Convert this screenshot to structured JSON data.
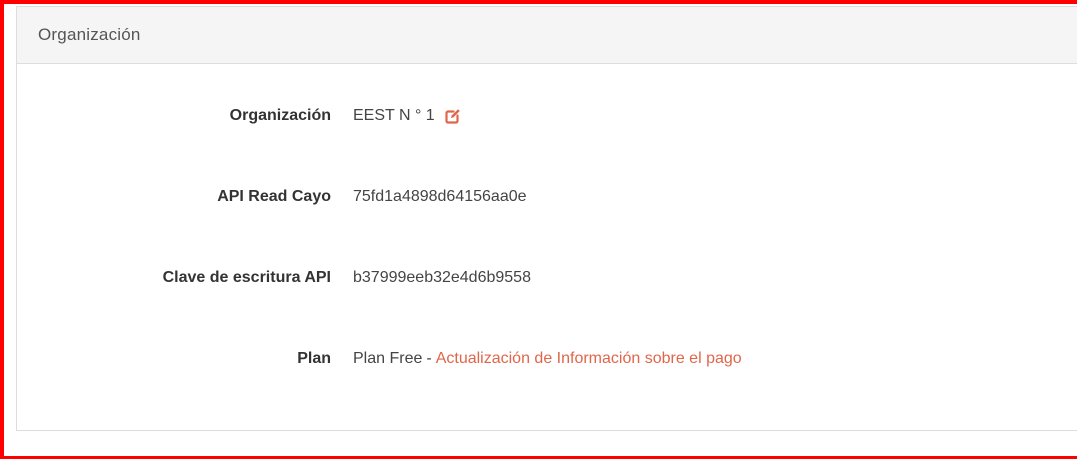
{
  "panel": {
    "heading": "Organización"
  },
  "fields": [
    {
      "label": "Organización",
      "value": "EEST N ° 1"
    },
    {
      "label": "API Read Cayo",
      "value": "75fd1a4898d64156aa0e"
    },
    {
      "label": "Clave de escritura API",
      "value": "b37999eeb32e4d6b9558"
    },
    {
      "label": "Plan",
      "value": "Plan Free"
    }
  ],
  "plan": {
    "separator": "-",
    "link_label": "Actualización de Información sobre el pago"
  },
  "icons": {
    "edit": "edit-icon"
  },
  "colors": {
    "accent": "#e0664a",
    "highlight_frame": "#ff0000",
    "heading_bg": "#f5f5f5"
  }
}
